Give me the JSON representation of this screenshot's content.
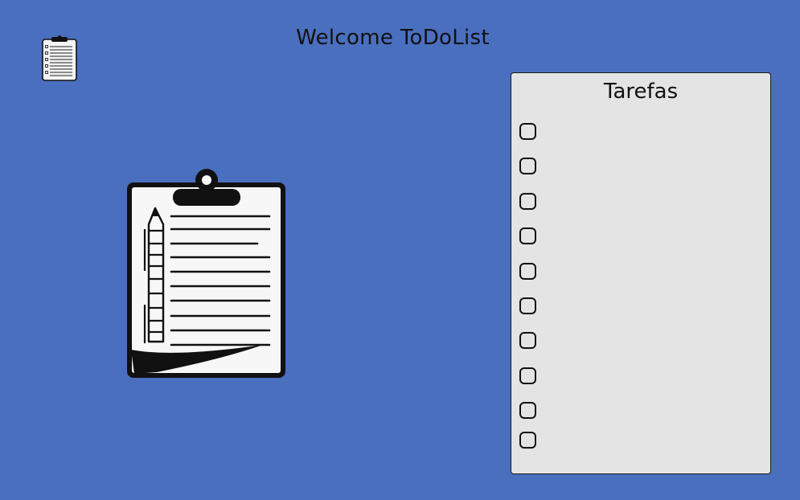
{
  "app": {
    "title": "Welcome ToDoList",
    "logo_icon": "clipboard-icon",
    "background_color": "#4a6fbf"
  },
  "hero": {
    "icon": "clipboard-with-pencil-icon"
  },
  "tasks_panel": {
    "title": "Tarefas",
    "background_color": "#e4e4e4",
    "tasks": [
      {
        "checked": false,
        "label": ""
      },
      {
        "checked": false,
        "label": ""
      },
      {
        "checked": false,
        "label": ""
      },
      {
        "checked": false,
        "label": ""
      },
      {
        "checked": false,
        "label": ""
      },
      {
        "checked": false,
        "label": ""
      },
      {
        "checked": false,
        "label": ""
      },
      {
        "checked": false,
        "label": ""
      },
      {
        "checked": false,
        "label": ""
      },
      {
        "checked": false,
        "label": ""
      }
    ]
  }
}
